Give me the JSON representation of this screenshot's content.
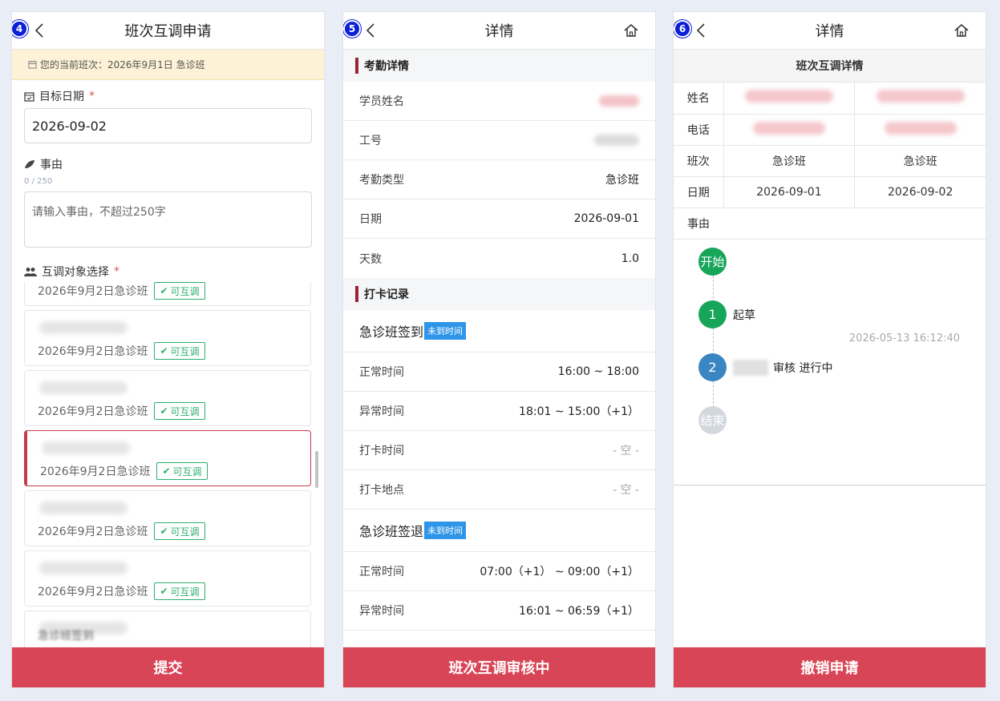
{
  "panel1": {
    "step": "4",
    "title": "班次互调申请",
    "notice": "您的当前班次：2026年9月1日 急诊班",
    "target_date_label": "目标日期",
    "target_date_value": "2026-09-02",
    "reason_label": "事由",
    "reason_counter": "0 / 250",
    "reason_placeholder": "请输入事由，不超过250字",
    "swap_label": "互调对象选择",
    "candidates": [
      {
        "shift": "2026年9月2日急诊班",
        "tag": "可互调"
      },
      {
        "shift": "2026年9月2日急诊班",
        "tag": "可互调"
      },
      {
        "shift": "2026年9月2日急诊班",
        "tag": "可互调"
      },
      {
        "shift": "2026年9月2日急诊班",
        "tag": "可互调"
      },
      {
        "shift": "2026年9月2日急诊班",
        "tag": "可互调"
      },
      {
        "shift": "2026年9月2日急诊班",
        "tag": "可互调"
      },
      {
        "shift": "急诊班签到",
        "tag": ""
      }
    ],
    "submit": "提交"
  },
  "panel2": {
    "step": "5",
    "title": "详情",
    "attendance_head": "考勤详情",
    "rows": [
      {
        "label": "学员姓名",
        "value": ""
      },
      {
        "label": "工号",
        "value": ""
      },
      {
        "label": "考勤类型",
        "value": "急诊班"
      },
      {
        "label": "日期",
        "value": "2026-09-01"
      },
      {
        "label": "天数",
        "value": "1.0"
      }
    ],
    "punch_head": "打卡记录",
    "checkin": {
      "title": "急诊班签到",
      "status": "未到时间",
      "rows": [
        {
          "label": "正常时间",
          "value": "16:00 ~ 18:00"
        },
        {
          "label": "异常时间",
          "value": "18:01 ~ 15:00（+1）"
        },
        {
          "label": "打卡时间",
          "value": "- 空 -"
        },
        {
          "label": "打卡地点",
          "value": "- 空 -"
        }
      ]
    },
    "checkout": {
      "title": "急诊班签退",
      "status": "未到时间",
      "rows": [
        {
          "label": "正常时间",
          "value": "07:00（+1） ~ 09:00（+1）"
        },
        {
          "label": "异常时间",
          "value": "16:01 ~ 06:59（+1）"
        }
      ]
    },
    "status_button": "班次互调审核中"
  },
  "panel3": {
    "step": "6",
    "title": "详情",
    "detail_title": "班次互调详情",
    "table": {
      "name_label": "姓名",
      "phone_label": "电话",
      "shift_label": "班次",
      "date_label": "日期",
      "shift_a": "急诊班",
      "shift_b": "急诊班",
      "date_a": "2026-09-01",
      "date_b": "2026-09-02"
    },
    "reason_label": "事由",
    "flow": {
      "start": "开始",
      "step1_num": "1",
      "step1_label": "起草",
      "step1_time": "2026-05-13 16:12:40",
      "step2_num": "2",
      "step2_label": "审核 进行中",
      "end": "结束"
    },
    "cancel": "撤销申请"
  },
  "colors": {
    "primary_button": "#d84557",
    "ok_tag": "#2eae6f",
    "pill_blue": "#2e95e8",
    "flow_green": "#17a55a",
    "flow_blue": "#3a86c2"
  }
}
